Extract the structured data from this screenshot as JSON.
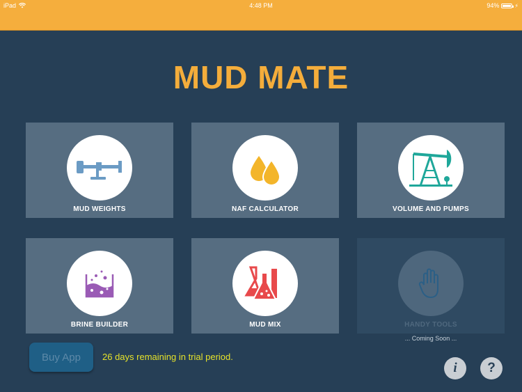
{
  "status_bar": {
    "device": "iPad",
    "time": "4:48 PM",
    "battery": "94%"
  },
  "app": {
    "title": "MUD MATE"
  },
  "tiles": [
    {
      "label": "MUD WEIGHTS",
      "icon": "mud-balance-icon",
      "enabled": true
    },
    {
      "label": "NAF CALCULATOR",
      "icon": "oil-drops-icon",
      "enabled": true
    },
    {
      "label": "VOLUME AND PUMPS",
      "icon": "pump-jack-icon",
      "enabled": true
    },
    {
      "label": "BRINE BUILDER",
      "icon": "beaker-icon",
      "enabled": true
    },
    {
      "label": "MUD MIX",
      "icon": "flasks-icon",
      "enabled": true
    },
    {
      "label": "HANDY TOOLS",
      "icon": "hand-icon",
      "enabled": false
    }
  ],
  "coming_soon": "... Coming Soon ...",
  "footer": {
    "buy_label": "Buy App",
    "trial_text": "26 days remaining in trial period.",
    "info_label": "i",
    "help_label": "?"
  },
  "colors": {
    "background": "#263f56",
    "status_bar": "#f5ae3d",
    "title": "#f4ad3b",
    "tile": "#566d81",
    "tile_disabled": "#2f4a62",
    "trial_text": "#e5e22a",
    "buy_button": "#1f5f86",
    "icon_blue": "#6b9bc4",
    "icon_yellow": "#f3b52a",
    "icon_teal": "#1fa79a",
    "icon_purple": "#9a5bb5",
    "icon_red": "#e8494b"
  }
}
